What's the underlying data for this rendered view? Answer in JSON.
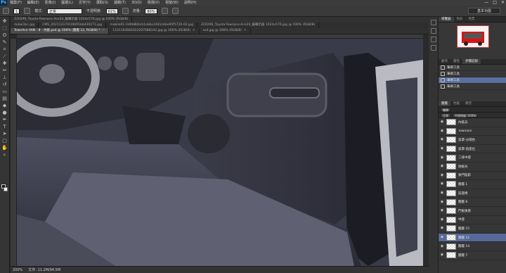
{
  "app": {
    "logo": "Ps",
    "menus": [
      "檔案(F)",
      "編輯(E)",
      "影像(I)",
      "圖層(L)",
      "文字(Y)",
      "選取(S)",
      "濾鏡(T)",
      "3D(D)",
      "檢視(V)",
      "視窗(W)",
      "說明(H)"
    ],
    "window_controls": [
      "—",
      "□",
      "✕"
    ]
  },
  "options": {
    "brush_size": "1",
    "mode_label": "模式:",
    "mode_value": "正常",
    "opacity_label": "不透明度:",
    "opacity_value": "61%",
    "flow_label": "流量:",
    "flow_value": "80%",
    "workspace": "基本功能"
  },
  "tabs_row1": [
    {
      "label": "Z20299_Toyota-Townace-Ace24_編輯示器 1024x576.jpg @ 100% (RGB/8)"
    }
  ],
  "tabs_row2": [
    {
      "label": "dubai1bc.jpg"
    },
    {
      "label": "CMS_2021121701060f1bb430271.jpg"
    },
    {
      "label": "mobile01-0d0b8b6cb1ebbc2481cbbe95f5720-02.jpg"
    },
    {
      "label": "Z20299_Toyota-Townace-Ace24_編輯示器 1024x576.jpg @ 100% (RGB/8)"
    }
  ],
  "tabs_row3": [
    {
      "label": "TownAce VAN - 8 - 內裝.psd @ 200% (圖層 12, RGB/8) *",
      "active": true
    },
    {
      "label": "1101183682022207088102.jpg @ 200% (RGB/8)"
    },
    {
      "label": "ssd.jpg @ 200% (RGB/8)"
    }
  ],
  "status": {
    "zoom": "200%",
    "doc": "文件: 11.2M/94.5M"
  },
  "navigator": {
    "tabs": [
      "導覽器",
      "色彩",
      "色票"
    ]
  },
  "history": {
    "tabs": [
      "動作",
      "屬性",
      "步驟記錄"
    ],
    "items": [
      {
        "label": "筆刷工具"
      },
      {
        "label": "筆刷工具"
      },
      {
        "label": "筆刷工具",
        "active": true
      },
      {
        "label": "筆刷工具"
      }
    ]
  },
  "layers": {
    "tabs": [
      "圖層",
      "色版",
      "路徑"
    ],
    "kind": "種類",
    "blend": "正常",
    "opacity": "不透明度: 100%",
    "items": [
      {
        "name": "內裝去"
      },
      {
        "name": "Townace"
      },
      {
        "name": "遮罩-分隔色"
      },
      {
        "name": "遮罩-前座位"
      },
      {
        "name": "二排中座"
      },
      {
        "name": "地板光"
      },
      {
        "name": "後門陰影"
      },
      {
        "name": "圖層 1"
      },
      {
        "name": "前座椅"
      },
      {
        "name": "圖層 8"
      },
      {
        "name": "門板後者"
      },
      {
        "name": "中座"
      },
      {
        "name": "圖層 15"
      },
      {
        "name": "圖層 12",
        "active": true
      },
      {
        "name": "圖層 14"
      },
      {
        "name": "圖層 7"
      }
    ]
  }
}
